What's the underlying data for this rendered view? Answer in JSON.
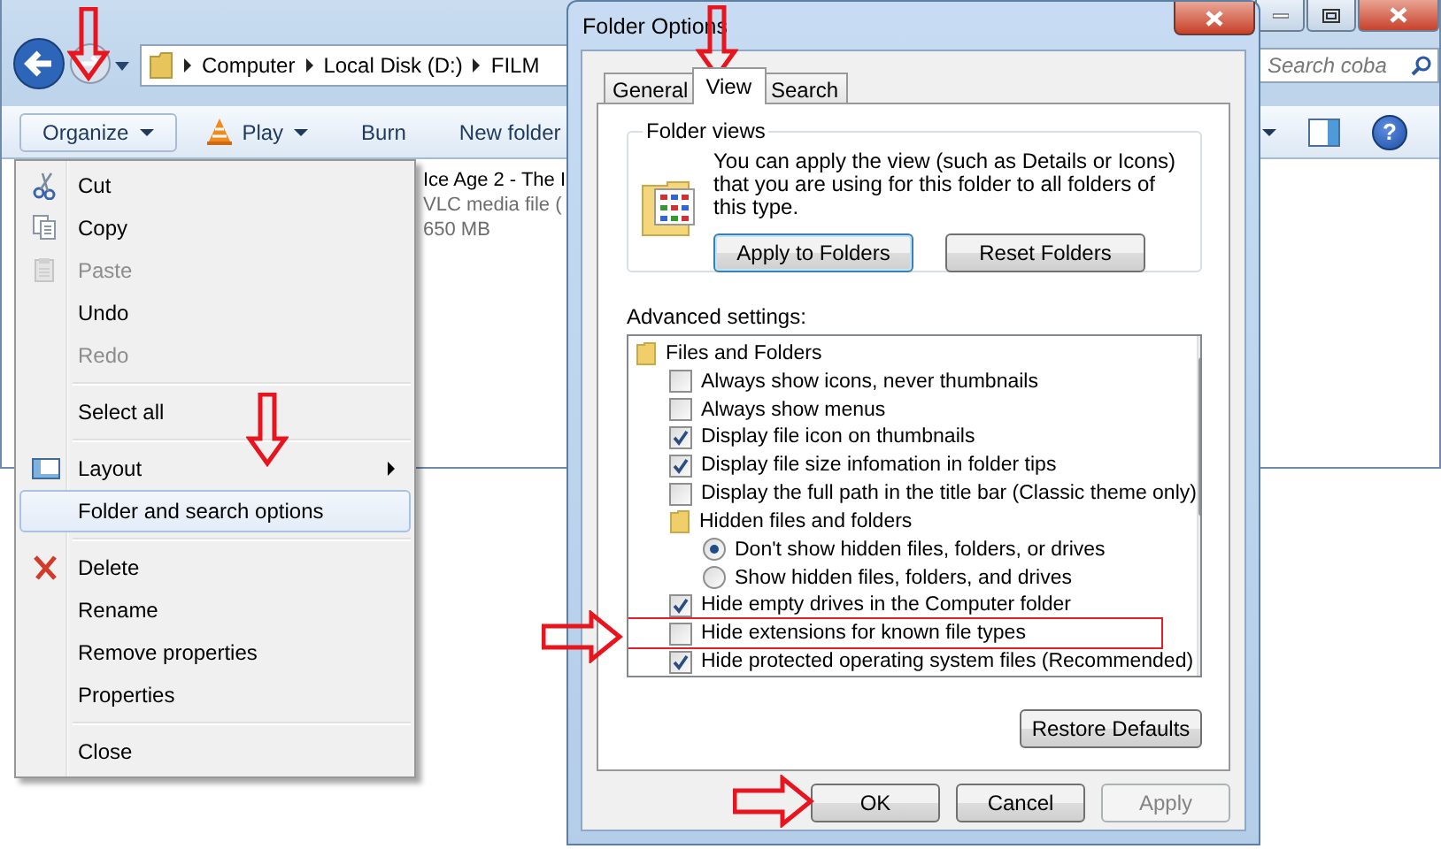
{
  "explorer": {
    "address": [
      "Computer",
      "Local Disk (D:)",
      "FILM"
    ],
    "search": {
      "placeholder": "Search coba"
    },
    "toolbar": [
      {
        "label": "Organize",
        "dropdown": true
      },
      {
        "label": "Play",
        "dropdown": true
      },
      {
        "label": "Burn",
        "dropdown": false
      },
      {
        "label": "New folder",
        "dropdown": false
      }
    ],
    "help_button": "?",
    "file": {
      "name": "Ice Age 2 - The I",
      "type": "VLC media file (",
      "size": "650 MB"
    }
  },
  "organize_menu": {
    "items": [
      {
        "kind": "item",
        "label": "Cut",
        "disabled": false,
        "selected": false,
        "submenu": false
      },
      {
        "kind": "item",
        "label": "Copy",
        "disabled": false,
        "selected": false,
        "submenu": false
      },
      {
        "kind": "item",
        "label": "Paste",
        "disabled": true,
        "selected": false,
        "submenu": false
      },
      {
        "kind": "item",
        "label": "Undo",
        "disabled": false,
        "selected": false,
        "submenu": false
      },
      {
        "kind": "item",
        "label": "Redo",
        "disabled": true,
        "selected": false,
        "submenu": false
      },
      {
        "kind": "separator"
      },
      {
        "kind": "item",
        "label": "Select all",
        "disabled": false,
        "selected": false,
        "submenu": false
      },
      {
        "kind": "separator"
      },
      {
        "kind": "item",
        "label": "Layout",
        "disabled": false,
        "selected": false,
        "submenu": true
      },
      {
        "kind": "item",
        "label": "Folder and search options",
        "disabled": false,
        "selected": true,
        "submenu": false
      },
      {
        "kind": "separator"
      },
      {
        "kind": "item",
        "label": "Delete",
        "disabled": false,
        "selected": false,
        "submenu": false
      },
      {
        "kind": "item",
        "label": "Rename",
        "disabled": false,
        "selected": false,
        "submenu": false
      },
      {
        "kind": "item",
        "label": "Remove properties",
        "disabled": false,
        "selected": false,
        "submenu": false
      },
      {
        "kind": "item",
        "label": "Properties",
        "disabled": false,
        "selected": false,
        "submenu": false
      },
      {
        "kind": "separator"
      },
      {
        "kind": "item",
        "label": "Close",
        "disabled": false,
        "selected": false,
        "submenu": false
      }
    ]
  },
  "dialog": {
    "title": "Folder Options",
    "tabs": [
      {
        "label": "General",
        "selected": false
      },
      {
        "label": "View",
        "selected": true
      },
      {
        "label": "Search",
        "selected": false
      }
    ],
    "folder_views": {
      "legend": "Folder views",
      "text": "You can apply the view (such as Details or Icons) that you are using for this folder to all folders of this type.",
      "buttons": [
        {
          "label": "Apply to Folders",
          "focused": true
        },
        {
          "label": "Reset Folders",
          "focused": false
        }
      ]
    },
    "advanced_label": "Advanced settings:",
    "tree": [
      {
        "kind": "folder",
        "label": "Files and Folders",
        "children": [
          {
            "kind": "checkbox",
            "label": "Always show icons, never thumbnails",
            "checked": false,
            "highlighted": false
          },
          {
            "kind": "checkbox",
            "label": "Always show menus",
            "checked": false,
            "highlighted": false
          },
          {
            "kind": "checkbox",
            "label": "Display file icon on thumbnails",
            "checked": true,
            "highlighted": false
          },
          {
            "kind": "checkbox",
            "label": "Display file size infomation in folder tips",
            "checked": true,
            "highlighted": false
          },
          {
            "kind": "checkbox",
            "label": "Display the full path in the title bar (Classic theme only)",
            "checked": false,
            "highlighted": false
          },
          {
            "kind": "folder",
            "label": "Hidden files and folders",
            "children": [
              {
                "kind": "radio",
                "label": "Don't show hidden files, folders, or drives",
                "selected": true,
                "highlighted": false
              },
              {
                "kind": "radio",
                "label": "Show hidden files, folders, and drives",
                "selected": false,
                "highlighted": false
              }
            ]
          },
          {
            "kind": "checkbox",
            "label": "Hide empty drives in the Computer folder",
            "checked": true,
            "highlighted": false
          },
          {
            "kind": "checkbox",
            "label": "Hide extensions for known file types",
            "checked": false,
            "highlighted": true
          },
          {
            "kind": "checkbox",
            "label": "Hide protected operating system files (Recommended)",
            "checked": true,
            "highlighted": false
          }
        ]
      }
    ],
    "restore_button": "Restore Defaults",
    "buttons": [
      {
        "label": "OK",
        "disabled": false
      },
      {
        "label": "Cancel",
        "disabled": false
      },
      {
        "label": "Apply",
        "disabled": true
      }
    ]
  }
}
